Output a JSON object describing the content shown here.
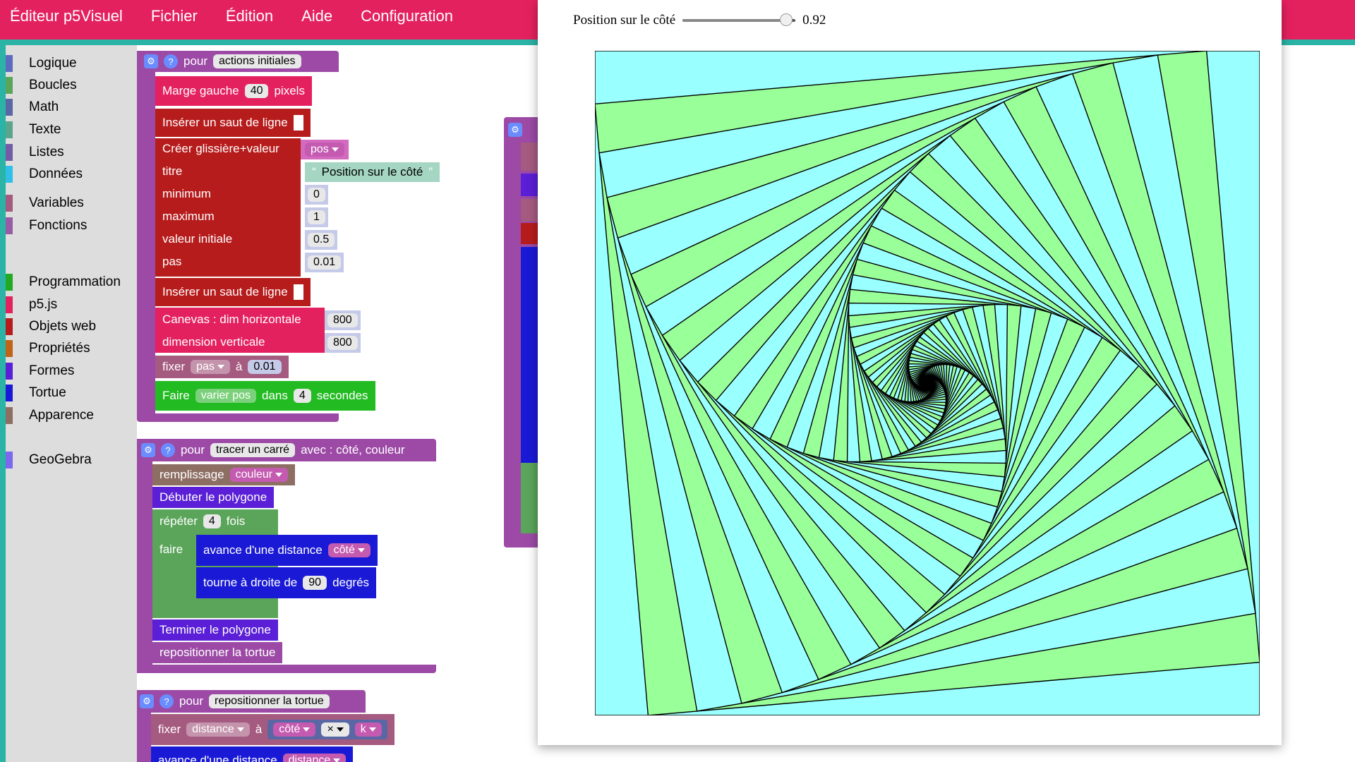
{
  "app": {
    "title": "Éditeur p5Visuel",
    "menu": [
      "Fichier",
      "Édition",
      "Aide",
      "Configuration"
    ],
    "accent": "#e4215f",
    "teal": "#2bb3a6"
  },
  "toolbox": {
    "items": [
      {
        "label": "Logique",
        "color": "#5c6bc0"
      },
      {
        "label": "Boucles",
        "color": "#5ba55b"
      },
      {
        "label": "Math",
        "color": "#5b67a5"
      },
      {
        "label": "Texte",
        "color": "#5ba58c"
      },
      {
        "label": "Listes",
        "color": "#745ba5"
      },
      {
        "label": "Données",
        "color": "#30bfe8"
      },
      {
        "label": "Variables",
        "color": "#a55b80"
      },
      {
        "label": "Fonctions",
        "color": "#995ba5"
      },
      {
        "label": "Programmation",
        "color": "#22aa22"
      },
      {
        "label": "p5.js",
        "color": "#e4215f"
      },
      {
        "label": "Objets web",
        "color": "#b71c1c"
      },
      {
        "label": "Propriétés",
        "color": "#c0641a"
      },
      {
        "label": "Formes",
        "color": "#5a1fd6"
      },
      {
        "label": "Tortue",
        "color": "#1a1ad6"
      },
      {
        "label": "Apparence",
        "color": "#8d6e63"
      },
      {
        "label": "GeoGebra",
        "color": "#7b68ee"
      }
    ]
  },
  "blocks": {
    "setup": {
      "header_pour": "pour",
      "header_name": "actions initiales",
      "marge_label": "Marge gauche",
      "marge_value": "40",
      "marge_unit": "pixels",
      "saut1": "Insérer un saut de ligne",
      "creer_label": "Créer glissière+valeur",
      "creer_var": "pos",
      "titre_label": "titre",
      "titre_value": "Position sur le côté",
      "minimum_label": "minimum",
      "minimum_value": "0",
      "maximum_label": "maximum",
      "maximum_value": "1",
      "initiale_label": "valeur initiale",
      "initiale_value": "0.5",
      "pas_label": "pas",
      "pas_value": "0.01",
      "saut2": "Insérer un saut de ligne",
      "canvas_label": "Canevas : dim horizontale",
      "canvas_h": "800",
      "dimv_label": "dimension verticale",
      "dimv_value": "800",
      "fixer_label": "fixer",
      "fixer_var": "pas",
      "fixer_a": "à",
      "fixer_value": "0.01",
      "faire_label": "Faire",
      "faire_func": "varier pos",
      "faire_dans": "dans",
      "faire_n": "4",
      "faire_unit": "secondes"
    },
    "carre": {
      "header_pour": "pour",
      "header_name": "tracer un carré",
      "header_args": "avec : côté, couleur",
      "remplissage_label": "remplissage",
      "remplissage_var": "couleur",
      "debuter": "Débuter le polygone",
      "repeter_label": "répéter",
      "repeter_n": "4",
      "repeter_fois": "fois",
      "faire": "faire",
      "avance_label": "avance d'une distance",
      "avance_var": "côté",
      "tourne_label": "tourne à droite de",
      "tourne_value": "90",
      "tourne_unit": "degrés",
      "terminer": "Terminer le polygone",
      "repositionner": "repositionner la tortue"
    },
    "reposition": {
      "header_pour": "pour",
      "header_name": "repositionner la tortue",
      "fixer_label": "fixer",
      "fixer_var": "distance",
      "fixer_a": "à",
      "cote_var": "côté",
      "op": "×",
      "k_var": "k",
      "avance_label": "avance d'une distance",
      "avance_var": "distance"
    }
  },
  "output": {
    "slider_label": "Position sur le côté",
    "slider_value": "0.92",
    "slider_fraction": 0.92,
    "fill_green": "#99ff99",
    "fill_cyan": "#99ffff",
    "square_count": 90
  }
}
